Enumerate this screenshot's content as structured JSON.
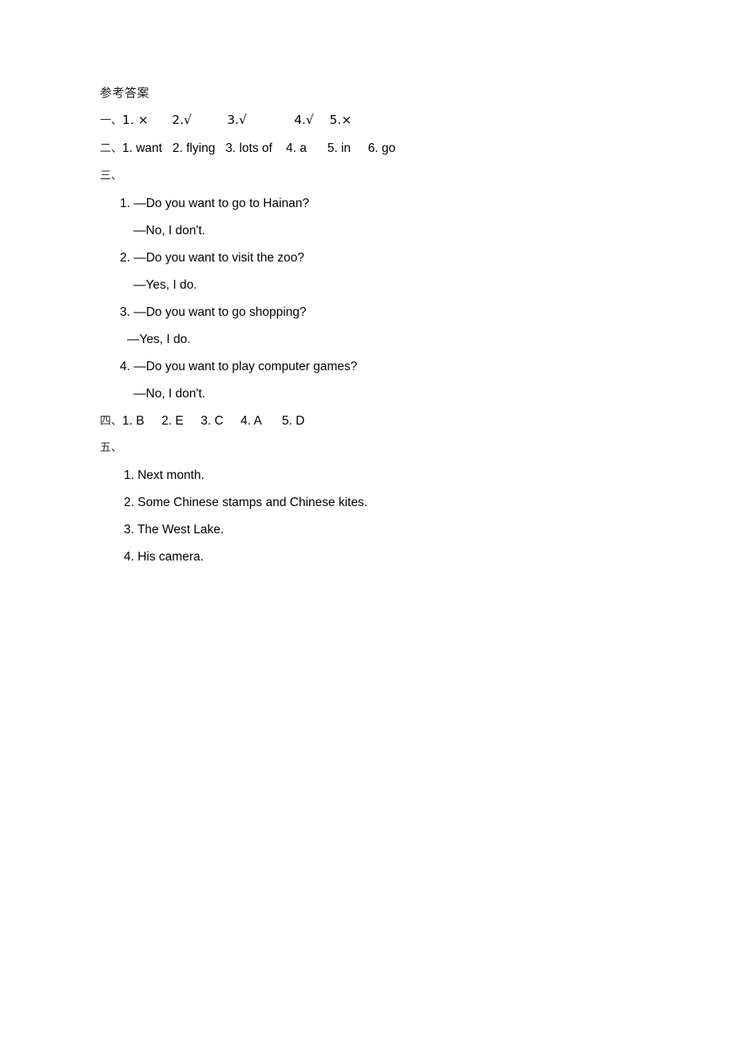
{
  "document": {
    "title": "参考答案",
    "background_color": "#ffffff",
    "text_color": "#000000"
  },
  "sections": [
    {
      "marker": "一、",
      "inline_answers": "1. ×      2.√         3.√            4.√    5.×"
    },
    {
      "marker": "二、",
      "inline_answers": "1. want   2. flying   3. lots of    4. a      5. in     6. go"
    },
    {
      "marker": "三、",
      "items": [
        {
          "question": "1. —Do you want to go to Hainan?",
          "reply": "—No, I don't."
        },
        {
          "question": "2. —Do you want to visit the zoo?",
          "reply": "—Yes, I do."
        },
        {
          "question": "3. —Do you want to go shopping?",
          "reply": "—Yes, I do."
        },
        {
          "question": "4. —Do you want to play computer games?",
          "reply": "—No, I don't."
        }
      ]
    },
    {
      "marker": "四、",
      "inline_answers": "1. B     2. E     3. C     4. A      5. D"
    },
    {
      "marker": "五、",
      "statements": [
        "1. Next month.",
        "2. Some Chinese stamps and Chinese kites.",
        "3. The West Lake.",
        "4. His camera."
      ]
    }
  ]
}
